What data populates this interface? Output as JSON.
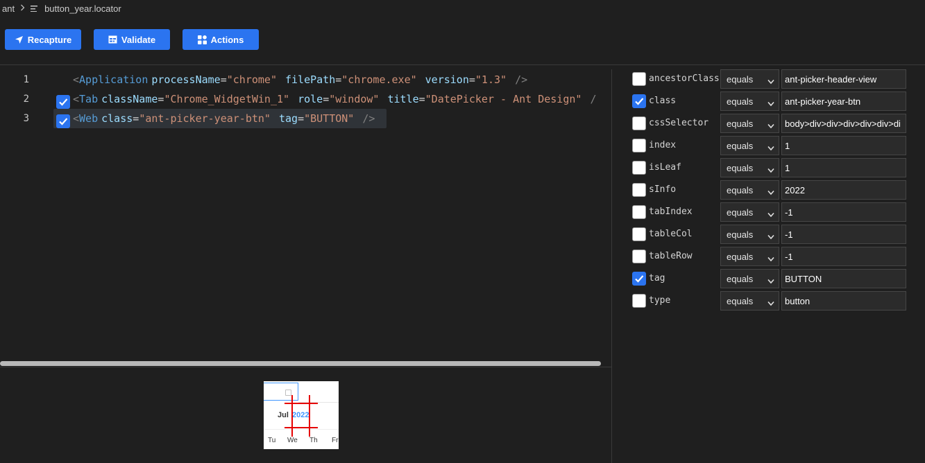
{
  "breadcrumb": {
    "root": "ant",
    "file": "button_year.locator"
  },
  "toolbar": {
    "recapture": "Recapture",
    "validate": "Validate",
    "actions": "Actions"
  },
  "editor": {
    "lines": [
      {
        "num": "1",
        "checked": null,
        "tag": "Application",
        "attrs": [
          {
            "name": "processName",
            "value": "\"chrome\""
          },
          {
            "name": "filePath",
            "value": "\"chrome.exe\""
          },
          {
            "name": "version",
            "value": "\"1.3\""
          }
        ],
        "close": "/>"
      },
      {
        "num": "2",
        "checked": true,
        "tag": "Tab",
        "attrs": [
          {
            "name": "className",
            "value": "\"Chrome_WidgetWin_1\""
          },
          {
            "name": "role",
            "value": "\"window\""
          },
          {
            "name": "title",
            "value": "\"DatePicker - Ant Design\""
          }
        ],
        "close": "/"
      },
      {
        "num": "3",
        "checked": true,
        "tag": "Web",
        "attrs": [
          {
            "name": "class",
            "value": "\"ant-picker-year-btn\""
          },
          {
            "name": "tag",
            "value": "\"BUTTON\""
          }
        ],
        "close": "/>"
      }
    ]
  },
  "preview": {
    "month": "Jul",
    "year": "2022",
    "weekdays": [
      "Tu",
      "We",
      "Th",
      "Fr"
    ]
  },
  "properties": [
    {
      "name": "ancestorClass",
      "checked": false,
      "op": "equals",
      "value": "ant-picker-header-view"
    },
    {
      "name": "class",
      "checked": true,
      "op": "equals",
      "value": "ant-picker-year-btn"
    },
    {
      "name": "cssSelector",
      "checked": false,
      "op": "equals",
      "value": "body>div>div>div>div>div>di"
    },
    {
      "name": "index",
      "checked": false,
      "op": "equals",
      "value": "1"
    },
    {
      "name": "isLeaf",
      "checked": false,
      "op": "equals",
      "value": "1"
    },
    {
      "name": "sInfo",
      "checked": false,
      "op": "equals",
      "value": "2022"
    },
    {
      "name": "tabIndex",
      "checked": false,
      "op": "equals",
      "value": "-1"
    },
    {
      "name": "tableCol",
      "checked": false,
      "op": "equals",
      "value": "-1"
    },
    {
      "name": "tableRow",
      "checked": false,
      "op": "equals",
      "value": "-1"
    },
    {
      "name": "tag",
      "checked": true,
      "op": "equals",
      "value": "BUTTON"
    },
    {
      "name": "type",
      "checked": false,
      "op": "equals",
      "value": "button"
    }
  ],
  "colors": {
    "accent": "#2b74f0",
    "background": "#1f1f1f",
    "highlight": "#e60000"
  },
  "icons": {
    "recapture": "send-icon",
    "validate": "table-icon",
    "actions": "grid-icon",
    "file": "file-lines-icon",
    "chevron": "chevron-right-icon"
  }
}
